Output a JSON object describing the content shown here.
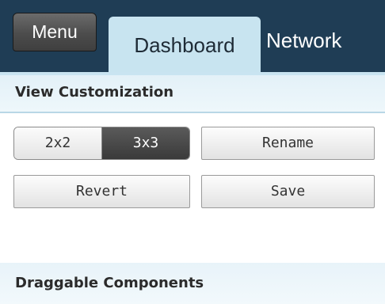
{
  "nav": {
    "menu_label": "Menu",
    "tabs": [
      {
        "label": "Dashboard",
        "active": true
      },
      {
        "label": "Network",
        "active": false
      }
    ]
  },
  "view_customization": {
    "title": "View Customization",
    "layout_options": [
      "2x2",
      "3x3"
    ],
    "selected_layout": "3x3",
    "rename_label": "Rename",
    "revert_label": "Revert",
    "save_label": "Save"
  },
  "draggable_components": {
    "title": "Draggable Components"
  },
  "colors": {
    "topbar": "#1f3d55",
    "active_tab": "#c8e4f0",
    "selected_segment": "#3a3a3a"
  }
}
